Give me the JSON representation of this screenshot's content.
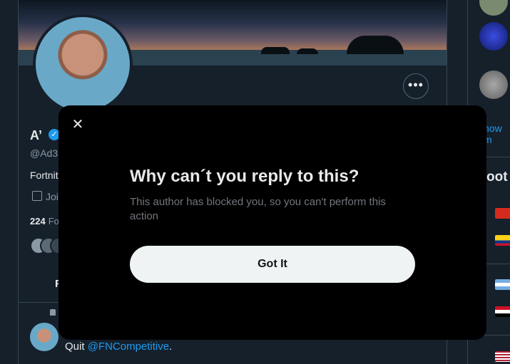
{
  "profile": {
    "name": "A’",
    "handle": "@Ad3",
    "bio": "Fortnit",
    "joined": "Joi",
    "followers_count": "224",
    "followers_label": "Fo",
    "tab": "F",
    "more_glyph": "•••"
  },
  "tweet": {
    "text": "Quit ",
    "mention": "@FNCompetitive",
    "suffix": "."
  },
  "sidebar": {
    "show_more": "how m",
    "section_heading": "oot"
  },
  "modal": {
    "title": "Why can´t you reply to this?",
    "body": "This author has blocked you, so you can't perform this action",
    "button_label": "Got It",
    "close_glyph": "✕"
  },
  "colors": {
    "background": "#15202b",
    "modal_background": "#000000",
    "accent": "#1d9bf0",
    "button_background": "#eff3f4"
  }
}
